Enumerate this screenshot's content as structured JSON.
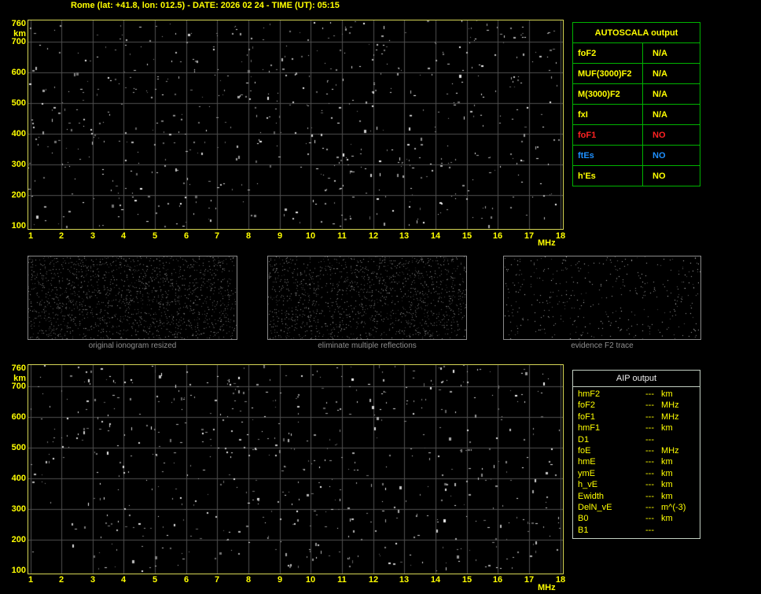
{
  "title": "Rome (lat: +41.8, lon: 012.5) - DATE: 2026 02 24 - TIME (UT): 05:15",
  "colors": {
    "background": "#000000",
    "axis_text": "#ffff00",
    "plot_border": "#d6d656",
    "grid": "#4f4f4f",
    "autoscala_border": "#00b400",
    "status_red": "#ff2222",
    "status_blue": "#1e90ff",
    "caption_gray": "#8f8f8f",
    "aip_border": "#c2cfc2",
    "aip_header_text": "#ededed"
  },
  "ionogram_top": {
    "y_axis_unit": "km",
    "x_axis_unit": "MHz",
    "y_range": [
      100,
      760
    ],
    "x_range": [
      1,
      18
    ],
    "y_ticks": [
      "760",
      "700",
      "600",
      "500",
      "400",
      "300",
      "200",
      "100"
    ],
    "x_ticks": [
      "1",
      "2",
      "3",
      "4",
      "5",
      "6",
      "7",
      "8",
      "9",
      "10",
      "11",
      "12",
      "13",
      "14",
      "15",
      "16",
      "17",
      "18"
    ],
    "grid_km": [
      700,
      600,
      500,
      400,
      300,
      200
    ],
    "noise": {
      "seed": 7,
      "count": 650
    }
  },
  "ionogram_bottom": {
    "y_axis_unit": "km",
    "x_axis_unit": "MHz",
    "y_range": [
      100,
      760
    ],
    "x_range": [
      1,
      18
    ],
    "y_ticks": [
      "760",
      "700",
      "600",
      "500",
      "400",
      "300",
      "200",
      "100"
    ],
    "x_ticks": [
      "1",
      "2",
      "3",
      "4",
      "5",
      "6",
      "7",
      "8",
      "9",
      "10",
      "11",
      "12",
      "13",
      "14",
      "15",
      "16",
      "17",
      "18"
    ],
    "grid_km": [
      700,
      600,
      500,
      400,
      300,
      200
    ],
    "noise": {
      "seed": 13,
      "count": 620
    }
  },
  "autoscala_panel": {
    "header": "AUTOSCALA output",
    "rows": [
      {
        "label": "foF2",
        "value": "N/A",
        "color": "#ffff00"
      },
      {
        "label": "MUF(3000)F2",
        "value": "N/A",
        "color": "#ffff00"
      },
      {
        "label": "M(3000)F2",
        "value": "N/A",
        "color": "#ffff00"
      },
      {
        "label": "fxI",
        "value": "N/A",
        "color": "#ffff00"
      },
      {
        "label": "foF1",
        "value": "NO",
        "color": "#ff2222"
      },
      {
        "label": "ftEs",
        "value": "NO",
        "color": "#1e90ff"
      },
      {
        "label": "h'Es",
        "value": "NO",
        "color": "#ffff00"
      }
    ]
  },
  "processing_panels": [
    {
      "caption": "original ionogram resized",
      "noise": {
        "seed": 21,
        "count": 1700,
        "min": 40,
        "max": 150
      }
    },
    {
      "caption": "eliminate multiple reflections",
      "noise": {
        "seed": 34,
        "count": 1500,
        "min": 40,
        "max": 155
      }
    },
    {
      "caption": "evidence F2 trace",
      "noise": {
        "seed": 55,
        "count": 400,
        "min": 60,
        "max": 210
      }
    }
  ],
  "aip_panel": {
    "header": "AIP output",
    "rows": [
      {
        "label": "hmF2",
        "value": "---",
        "unit": "km"
      },
      {
        "label": "foF2",
        "value": "---",
        "unit": "MHz"
      },
      {
        "label": "foF1",
        "value": "---",
        "unit": "MHz"
      },
      {
        "label": "hmF1",
        "value": "---",
        "unit": "km"
      },
      {
        "label": "D1",
        "value": "---",
        "unit": ""
      },
      {
        "label": "foE",
        "value": "---",
        "unit": "MHz"
      },
      {
        "label": "hmE",
        "value": "---",
        "unit": "km"
      },
      {
        "label": "ymE",
        "value": "---",
        "unit": "km"
      },
      {
        "label": "h_vE",
        "value": "---",
        "unit": "km"
      },
      {
        "label": "Ewidth",
        "value": "---",
        "unit": "km"
      },
      {
        "label": "DelN_vE",
        "value": "---",
        "unit": "m^(-3)"
      },
      {
        "label": "B0",
        "value": "---",
        "unit": "km"
      },
      {
        "label": "B1",
        "value": "---",
        "unit": ""
      }
    ]
  }
}
